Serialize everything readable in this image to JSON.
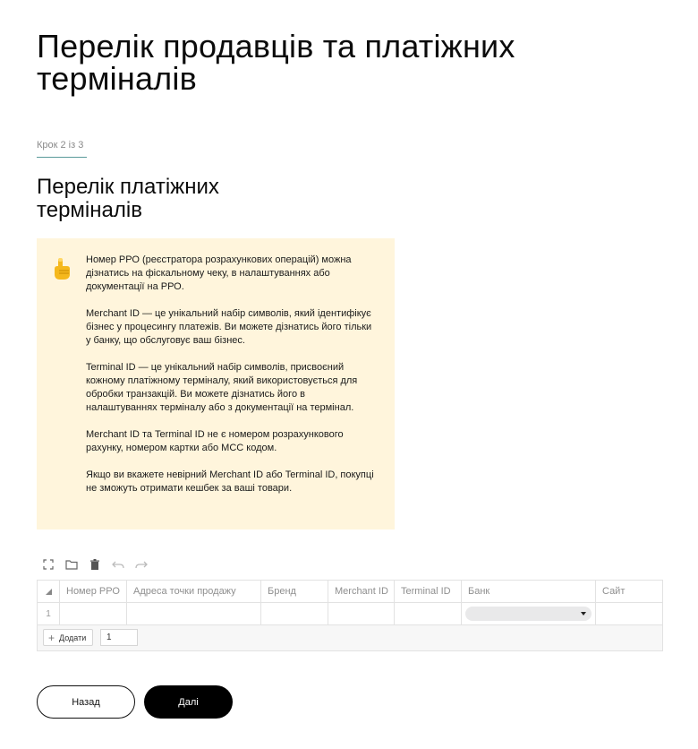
{
  "page": {
    "title": "Перелік продавців та платіжних терміналів",
    "step": "Крок 2 із 3",
    "section_title": "Перелік платіжних терміналів"
  },
  "info": {
    "icon": "pointing-up-hand-icon",
    "paragraphs": [
      "Номер РРО (реєстратора розрахункових операцій) можна дізнатись на фіскальному чеку, в налаштуваннях або документації на РРО.",
      "Merchant ID — це унікальний набір символів, який ідентифікує бізнес у процесингу платежів. Ви можете дізнатись його тільки у банку, що обслуговує ваш бізнес.",
      "Terminal ID — це унікальний набір символів, присвоєний кожному платіжному терміналу, який використовується для обробки транзакцій. Ви можете дізнатись його в налаштуваннях терміналу або з документації на термінал.",
      "Merchant ID та Terminal ID не є номером розрахункового рахунку, номером картки або MCC кодом.",
      "Якщо ви вкажете невірний Merchant ID або Terminal ID, покупці не зможуть отримати кешбек за ваші товари."
    ]
  },
  "toolbar": {
    "icons": [
      "fullscreen-icon",
      "folder-icon",
      "trash-icon",
      "undo-icon",
      "redo-icon"
    ]
  },
  "grid": {
    "columns": [
      "Номер РРО",
      "Адреса точки продажу",
      "Бренд",
      "Merchant ID",
      "Terminal ID",
      "Банк",
      "Сайт"
    ],
    "rows": [
      {
        "num": "1",
        "bank": ""
      }
    ],
    "add_label": "Додати",
    "add_count": "1"
  },
  "actions": {
    "back": "Назад",
    "next": "Далі"
  },
  "colors": {
    "info_bg": "#fff5dc",
    "primary": "#000000",
    "step_line": "#5a9a9a"
  }
}
